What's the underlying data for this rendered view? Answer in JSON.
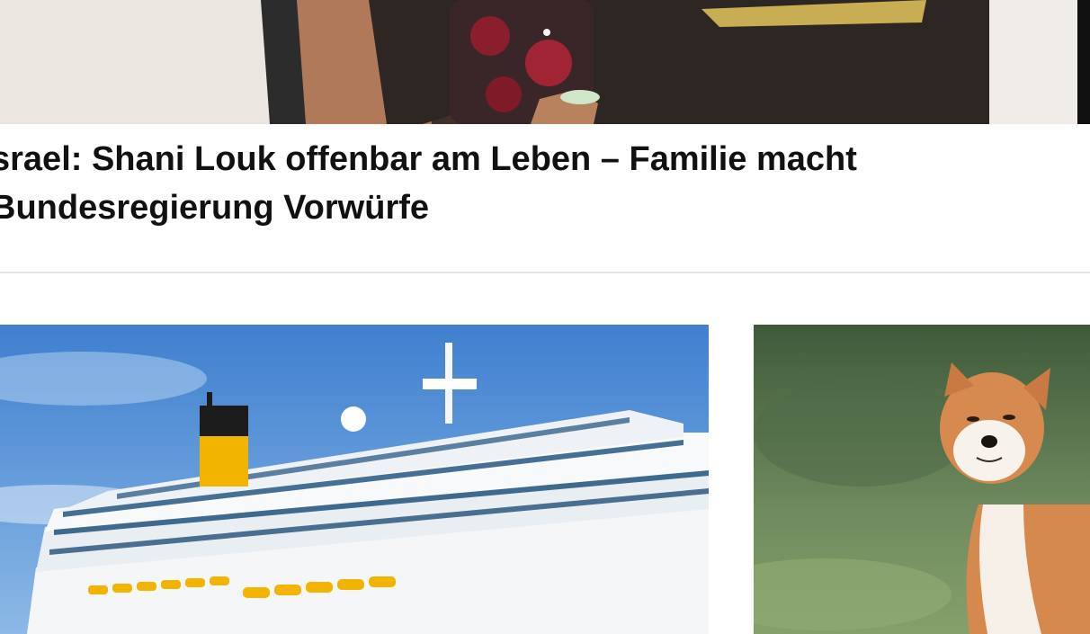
{
  "article": {
    "headline_line1": "srael: Shani Louk offenbar am Leben – Familie macht",
    "headline_line2": "Bundesregierung Vorwürfe"
  },
  "teasers": [
    {
      "image": "cruise-ship-photo"
    },
    {
      "image": "shiba-inu-dog-photo"
    }
  ],
  "colors": {
    "headline": "#111111",
    "divider": "#e6e6e6",
    "sky": "#4f8fd6",
    "funnel_yellow": "#f2b400"
  }
}
